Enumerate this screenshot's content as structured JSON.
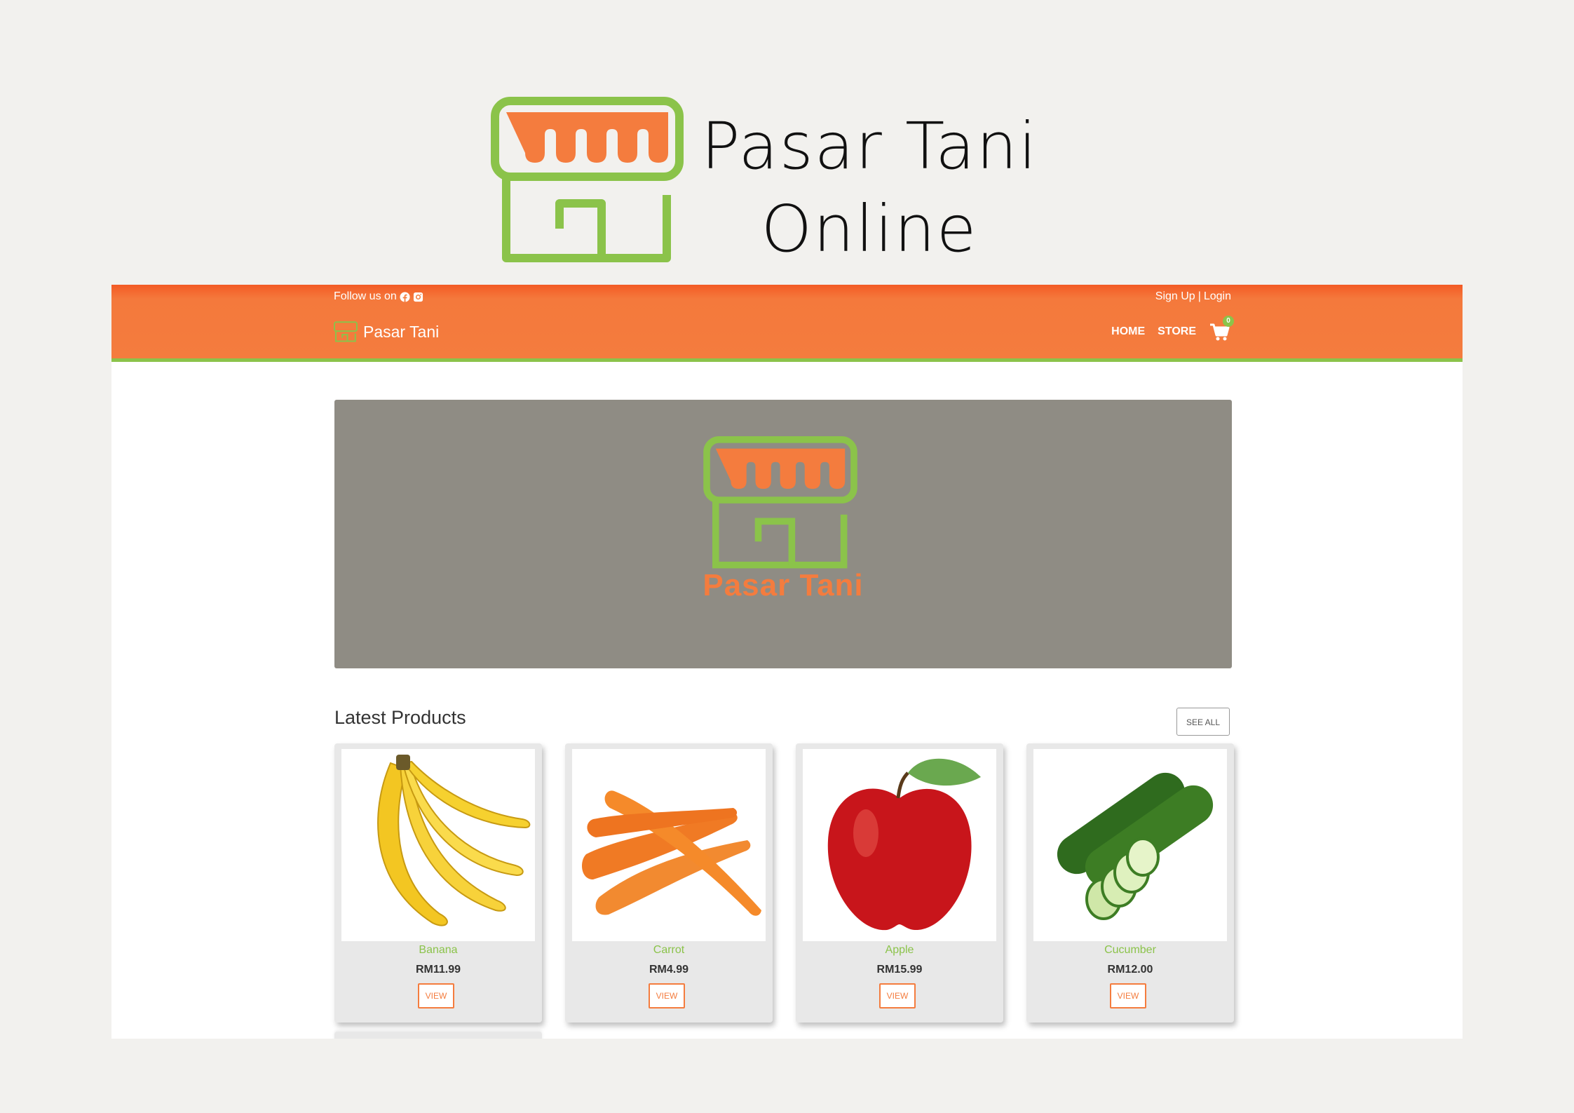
{
  "brand": {
    "title_line1": "Pasar Tani",
    "title_line2": "Online",
    "logo_icon": "market-stall-icon",
    "colors": {
      "orange": "#f47c3e",
      "green": "#8bc34a"
    }
  },
  "topbar": {
    "follow_text": "Follow us on",
    "social_icons": [
      "facebook-icon",
      "instagram-icon"
    ],
    "signup": "Sign Up",
    "separator": "|",
    "login": "Login"
  },
  "navbar": {
    "brand_name": "Pasar Tani",
    "links": [
      "HOME",
      "STORE"
    ],
    "cart_count": "0"
  },
  "banner": {
    "text": "Pasar Tani"
  },
  "products_section": {
    "title": "Latest Products",
    "see_all": "SEE ALL",
    "items": [
      {
        "name": "Banana",
        "price": "RM11.99",
        "button": "VIEW",
        "image": "banana"
      },
      {
        "name": "Carrot",
        "price": "RM4.99",
        "button": "VIEW",
        "image": "carrot"
      },
      {
        "name": "Apple",
        "price": "RM15.99",
        "button": "VIEW",
        "image": "apple"
      },
      {
        "name": "Cucumber",
        "price": "RM12.00",
        "button": "VIEW",
        "image": "cucumber"
      }
    ]
  }
}
